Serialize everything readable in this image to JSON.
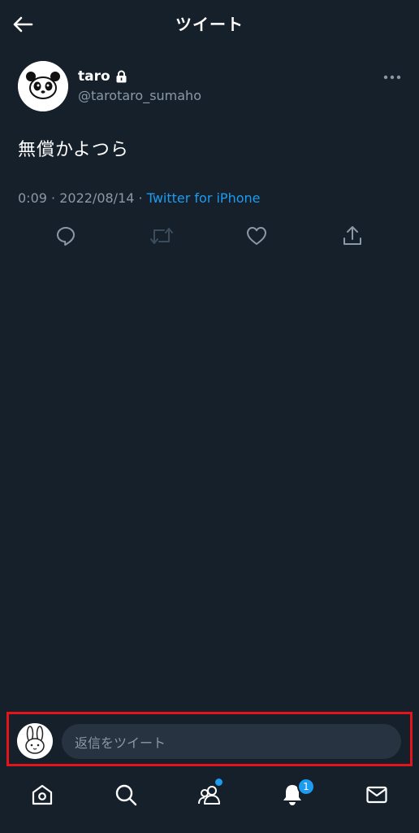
{
  "header": {
    "title": "ツイート",
    "back_icon": "arrow-left-icon"
  },
  "tweet": {
    "user": {
      "name": "taro",
      "handle": "@tarotaro_sumaho",
      "locked_icon": "lock-icon",
      "avatar": "panda-avatar"
    },
    "text": "無償かよつら",
    "time": "0:09",
    "date": "2022/08/14",
    "separator": " · ",
    "source": "Twitter for iPhone",
    "actions": [
      "reply-icon",
      "retweet-icon",
      "like-icon",
      "share-icon"
    ]
  },
  "reply": {
    "placeholder": "返信をツイート",
    "avatar": "rabbit-avatar",
    "highlight_color": "#e3141c"
  },
  "bottom_nav": {
    "items": [
      "home-icon",
      "search-icon",
      "communities-icon",
      "notifications-icon",
      "messages-icon"
    ],
    "notification_count": "1"
  },
  "colors": {
    "background": "#15202b",
    "accent": "#1d9bf0",
    "secondary_text": "#8b98a5",
    "input_bg": "#273340"
  }
}
